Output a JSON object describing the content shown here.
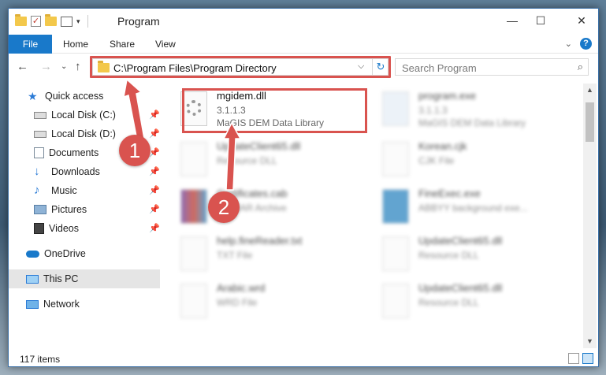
{
  "window": {
    "title": "Program",
    "controls": {
      "minimize": "—",
      "maximize": "☐",
      "close": "✕"
    }
  },
  "ribbon": {
    "file": "File",
    "tabs": [
      "Home",
      "Share",
      "View"
    ]
  },
  "address_bar": {
    "path": "C:\\Program Files\\Program Directory",
    "dropdown": "⌵",
    "refresh": "↻"
  },
  "search": {
    "placeholder": "Search Program",
    "icon": "⌕"
  },
  "nav": {
    "back": "←",
    "forward": "→",
    "recent": "⌄",
    "up": "↑"
  },
  "sidebar": {
    "items": [
      {
        "label": "Quick access",
        "icon": "star-icon",
        "color": "#2b7bd6"
      },
      {
        "label": "Local Disk (C:)",
        "icon": "drive-icon",
        "color": "#6c6c6c",
        "pinned": true
      },
      {
        "label": "Local Disk (D:)",
        "icon": "drive-icon",
        "color": "#6c6c6c",
        "pinned": true
      },
      {
        "label": "Documents",
        "icon": "documents-icon",
        "color": "#7a8a99",
        "pinned": true
      },
      {
        "label": "Downloads",
        "icon": "download-icon",
        "color": "#2b7bd6",
        "pinned": true
      },
      {
        "label": "Music",
        "icon": "music-icon",
        "color": "#2b7bd6",
        "pinned": true
      },
      {
        "label": "Pictures",
        "icon": "pictures-icon",
        "color": "#5a7fa5",
        "pinned": true
      },
      {
        "label": "Videos",
        "icon": "videos-icon",
        "color": "#444",
        "pinned": true
      },
      {
        "label": "OneDrive",
        "icon": "cloud-icon",
        "color": "#1979ca"
      },
      {
        "label": "This PC",
        "icon": "computer-icon",
        "color": "#2b7bd6",
        "selected": true
      },
      {
        "label": "Network",
        "icon": "network-icon",
        "color": "#2b7bd6"
      }
    ],
    "pin_glyph": "📌"
  },
  "files": [
    {
      "name": "mgidem.dll",
      "line2": "3.1.1.3",
      "line3": "MaGIS DEM Data Library",
      "highlighted": true
    },
    {
      "name": "program.exe",
      "line2": "3.1.1.3",
      "line3": "MaGIS DEM Data Library"
    },
    {
      "name": "UpdateClient65.dll",
      "line2": "Resource DLL",
      "line3": ""
    },
    {
      "name": "Korean.cjk",
      "line2": "CJK File",
      "line3": ""
    },
    {
      "name": "Certificates.cab",
      "line2": "WinRAR Archive",
      "line3": ""
    },
    {
      "name": "FineExec.exe",
      "line2": "ABBYY background exe...",
      "line3": ""
    },
    {
      "name": "help.fineReader.txt",
      "line2": "TXT File",
      "line3": ""
    },
    {
      "name": "UpdateClient65.dll",
      "line2": "Resource DLL",
      "line3": ""
    },
    {
      "name": "Arabic.wrd",
      "line2": "WRD File",
      "line3": ""
    },
    {
      "name": "UpdateClient65.dll",
      "line2": "Resource DLL",
      "line3": ""
    }
  ],
  "status": {
    "count": "117 items"
  },
  "callouts": {
    "one": "1",
    "two": "2"
  },
  "colors": {
    "accent": "#1979ca",
    "highlight": "#d9534f",
    "selected": "#e5e5e5"
  }
}
